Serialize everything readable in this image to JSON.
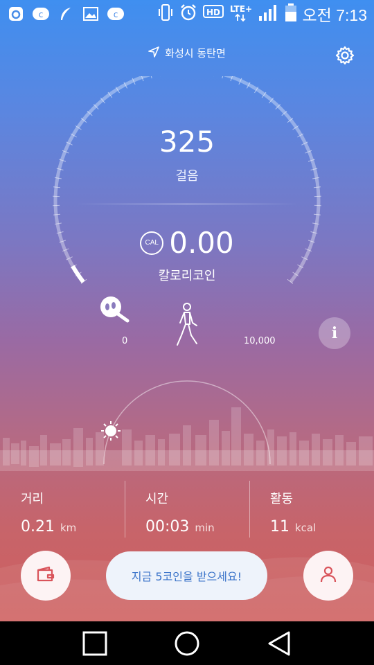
{
  "status_bar": {
    "icons_left": [
      "o-app-icon",
      "c-circle-icon",
      "feather-icon",
      "image-icon",
      "c-circle-icon"
    ],
    "icons_right": [
      "vibrate-icon",
      "alarm-icon",
      "hd-icon",
      "lte-icon",
      "signal-icon",
      "battery-icon"
    ],
    "time": "오전 7:13"
  },
  "header": {
    "location": "화성시 동탄면"
  },
  "gauge": {
    "steps": "325",
    "steps_label": "걸음",
    "cal_badge": "CAL",
    "calorie_coin": "0.00",
    "calorie_label": "칼로리코인",
    "min_label": "0",
    "max_label": "10,000",
    "info_label": "i",
    "progress_fraction": 0.0325
  },
  "stats": [
    {
      "label": "거리",
      "value": "0.21",
      "unit": "km"
    },
    {
      "label": "시간",
      "value": "00:03",
      "unit": "min"
    },
    {
      "label": "활동",
      "value": "11",
      "unit": "kcal"
    }
  ],
  "actions": {
    "coin_button": "지금 5코인을 받으세요!"
  },
  "colors": {
    "accent_blue": "#3a73c9",
    "accent_red": "#d9535a",
    "top_gradient": "#3f8ff0",
    "bottom_gradient": "#cf5f5e"
  }
}
